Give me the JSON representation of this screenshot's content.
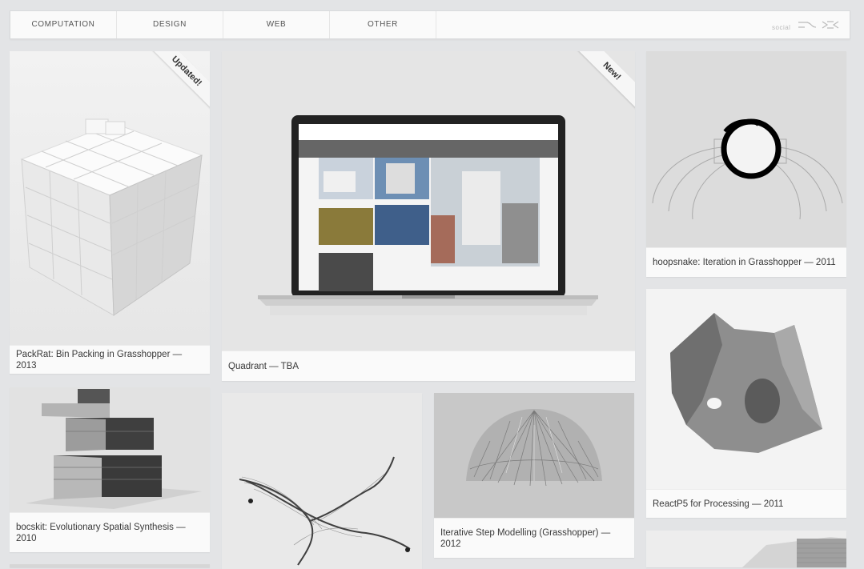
{
  "nav": {
    "items": [
      "COMPUTATION",
      "DESIGN",
      "WEB",
      "OTHER"
    ],
    "social_label": "social"
  },
  "cards": {
    "packrat": {
      "caption": "PackRat: Bin Packing in Grasshopper — 2013",
      "ribbon": "Updated!"
    },
    "quadrant": {
      "caption": "Quadrant — TBA",
      "ribbon": "New!"
    },
    "hoopsnake": {
      "caption": "hoopsnake: Iteration in Grasshopper — 2011"
    },
    "reactp5": {
      "caption": "ReactP5 for Processing — 2011"
    },
    "bocskit": {
      "caption": "bocskit: Evolutionary Spatial Synthesis — 2010"
    },
    "iterative": {
      "caption": "Iterative Step Modelling (Grasshopper) — 2012"
    }
  },
  "colors": {
    "background": "#e3e4e6",
    "card": "#fafafa",
    "text": "#3a3a3a"
  }
}
